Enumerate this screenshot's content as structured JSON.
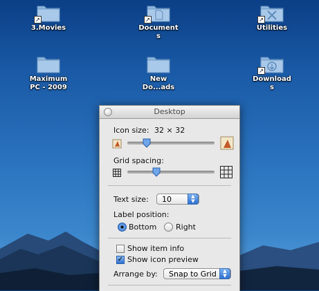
{
  "desktop": {
    "icons": [
      {
        "label": "3.Movies"
      },
      {
        "label": "Document\ns"
      },
      {
        "label": "Utilities"
      },
      {
        "label": "Maximum\nPC - 2009"
      },
      {
        "label": "New\nDo...ads"
      },
      {
        "label": "Download\ns"
      }
    ]
  },
  "panel": {
    "title": "Desktop",
    "icon_size_label": "Icon size:",
    "icon_size_value": "32 × 32",
    "icon_size_level": 0.22,
    "grid_spacing_label": "Grid spacing:",
    "grid_spacing_level": 0.33,
    "text_size_label": "Text size:",
    "text_size_value": "10",
    "label_position_label": "Label position:",
    "bottom_label": "Bottom",
    "right_label": "Right",
    "label_position_selected": "Bottom",
    "show_item_info_label": "Show item info",
    "show_item_info": false,
    "show_icon_preview_label": "Show icon preview",
    "show_icon_preview": true,
    "arrange_by_label": "Arrange by:",
    "arrange_by_value": "Snap to Grid"
  }
}
